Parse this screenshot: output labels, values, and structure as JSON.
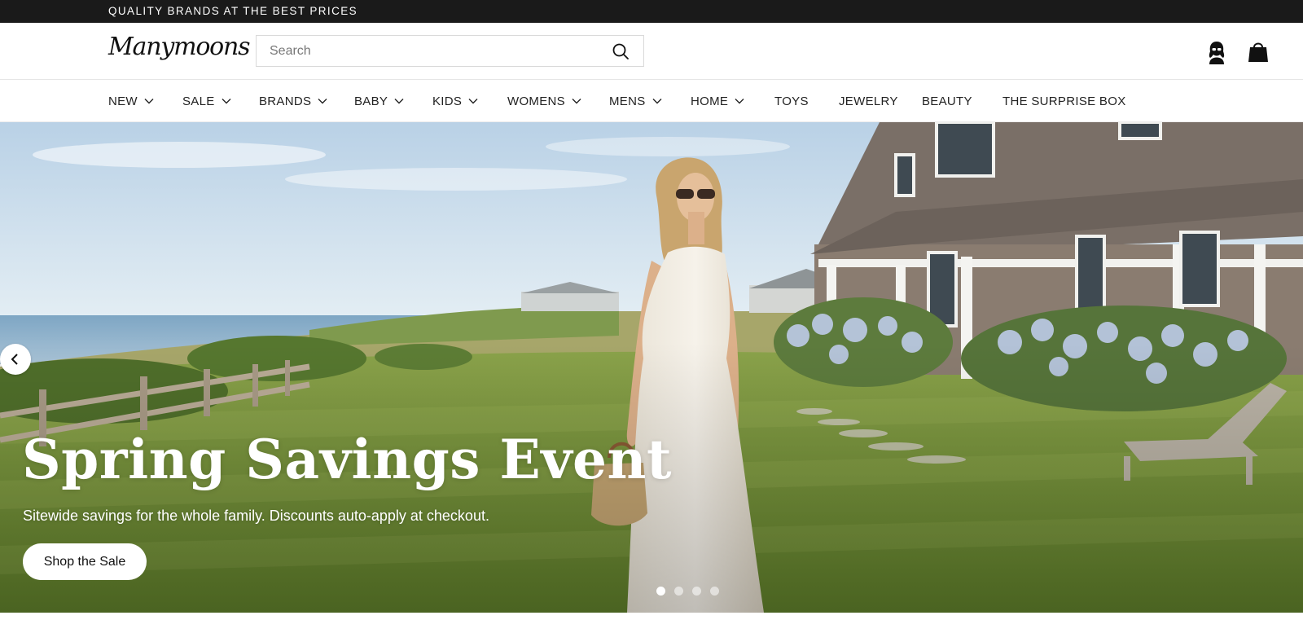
{
  "announcement": {
    "text": "QUALITY BRANDS AT THE BEST PRICES"
  },
  "header": {
    "logo": "Manymoons",
    "search": {
      "placeholder": "Search",
      "value": ""
    },
    "icons": [
      "search-icon",
      "account-icon",
      "shopping-bag-icon"
    ]
  },
  "nav": {
    "items": [
      {
        "label": "NEW",
        "has_dropdown": true
      },
      {
        "label": "SALE",
        "has_dropdown": true
      },
      {
        "label": "BRANDS",
        "has_dropdown": true
      },
      {
        "label": "BABY",
        "has_dropdown": true
      },
      {
        "label": "KIDS",
        "has_dropdown": true
      },
      {
        "label": "WOMENS",
        "has_dropdown": true
      },
      {
        "label": "MENS",
        "has_dropdown": true
      },
      {
        "label": "HOME",
        "has_dropdown": true
      },
      {
        "label": "TOYS",
        "has_dropdown": false
      },
      {
        "label": "JEWELRY",
        "has_dropdown": false
      },
      {
        "label": "BEAUTY",
        "has_dropdown": false
      },
      {
        "label": "THE SURPRISE BOX",
        "has_dropdown": false
      }
    ]
  },
  "hero": {
    "title": "Spring Savings Event",
    "subtitle": "Sitewide savings for the whole family. Discounts auto-apply at checkout.",
    "cta_label": "Shop the Sale",
    "slide_count": 4,
    "active_slide": 1
  },
  "colors": {
    "announcement_bg": "#1a1a1a",
    "text": "#111111",
    "hero_text": "#ffffff"
  }
}
